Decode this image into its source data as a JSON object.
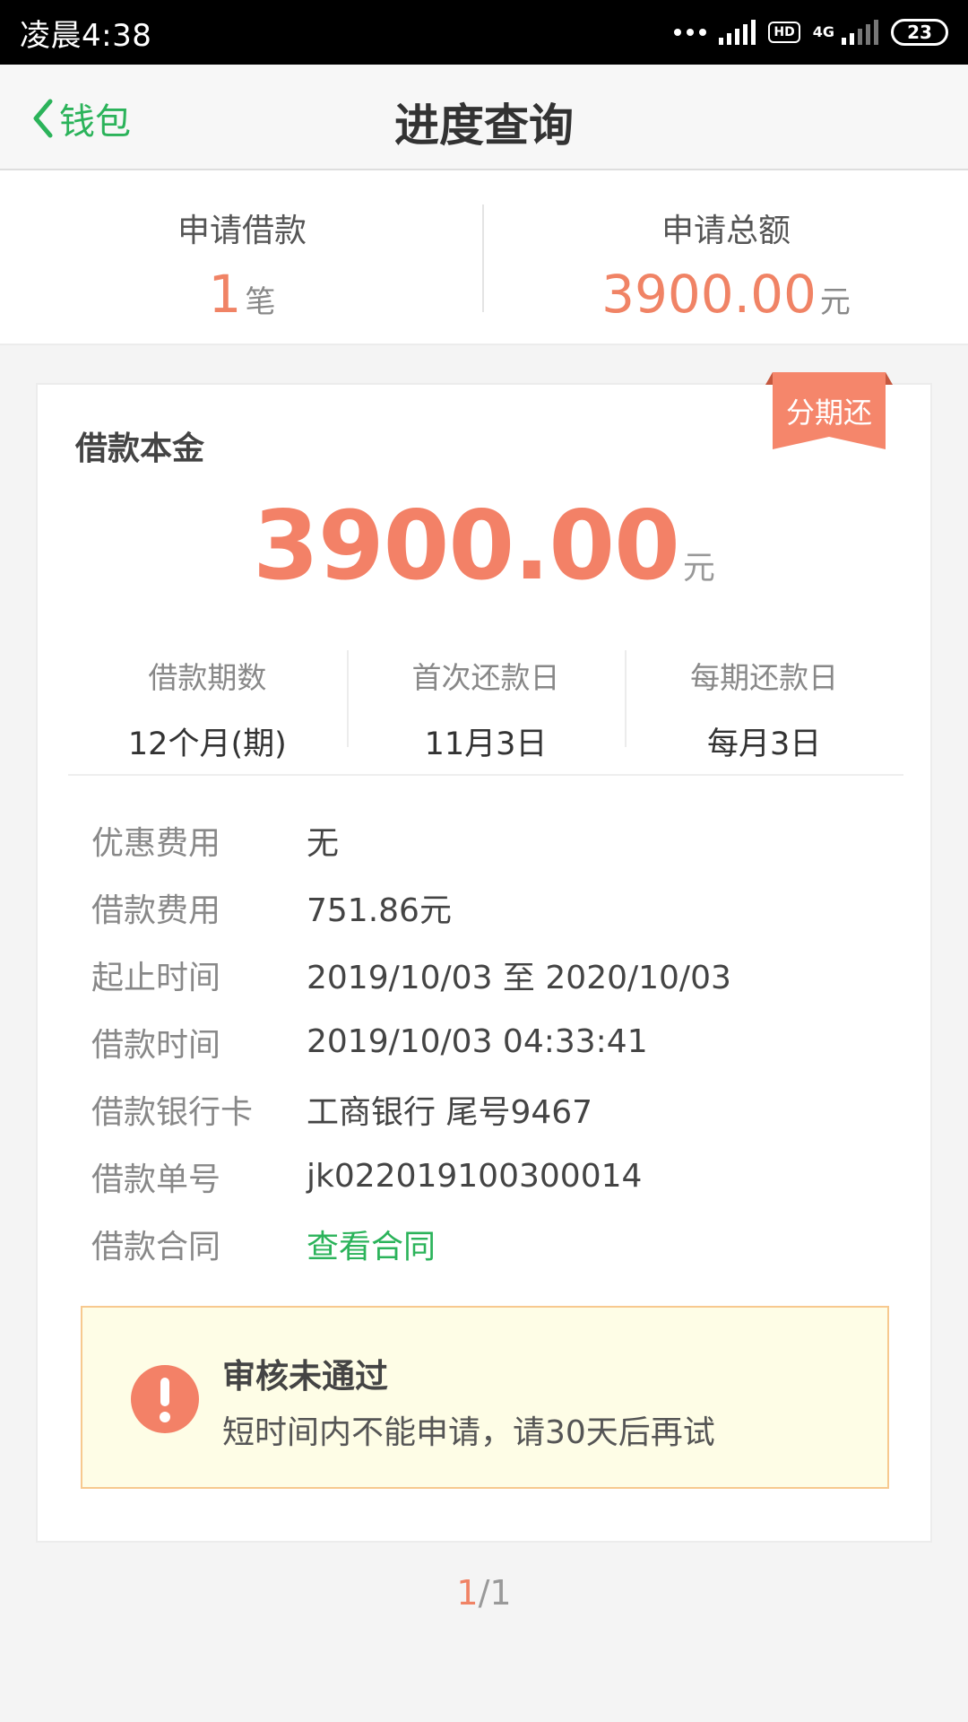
{
  "status_bar": {
    "time": "凌晨4:38",
    "hd": "HD",
    "network": "4G",
    "battery": "23"
  },
  "nav": {
    "back_label": "钱包",
    "title": "进度查询"
  },
  "summary": {
    "count_label": "申请借款",
    "count_value": "1",
    "count_unit": "笔",
    "total_label": "申请总额",
    "total_value": "3900.00",
    "total_unit": "元"
  },
  "card": {
    "badge": "分期还",
    "heading": "借款本金",
    "principal": "3900.00",
    "principal_unit": "元",
    "terms": [
      {
        "label": "借款期数",
        "value": "12个月(期)"
      },
      {
        "label": "首次还款日",
        "value": "11月3日"
      },
      {
        "label": "每期还款日",
        "value": "每月3日"
      }
    ],
    "details": [
      {
        "label": "优惠费用",
        "value": "无"
      },
      {
        "label": "借款费用",
        "value": "751.86元"
      },
      {
        "label": "起止时间",
        "value": "2019/10/03 至 2020/10/03"
      },
      {
        "label": "借款时间",
        "value": "2019/10/03 04:33:41"
      },
      {
        "label": "借款银行卡",
        "value": "工商银行 尾号9467"
      },
      {
        "label": "借款单号",
        "value": "jk022019100300014"
      },
      {
        "label": "借款合同",
        "value": "查看合同"
      }
    ],
    "alert": {
      "title": "审核未通过",
      "message": "短时间内不能申请，请30天后再试"
    }
  },
  "pager": {
    "current": "1",
    "total": "/1"
  },
  "colors": {
    "accent_green": "#2bb35a",
    "accent_orange": "#f08365",
    "alert_bg": "#fefde6",
    "alert_border": "#f7c98f"
  }
}
